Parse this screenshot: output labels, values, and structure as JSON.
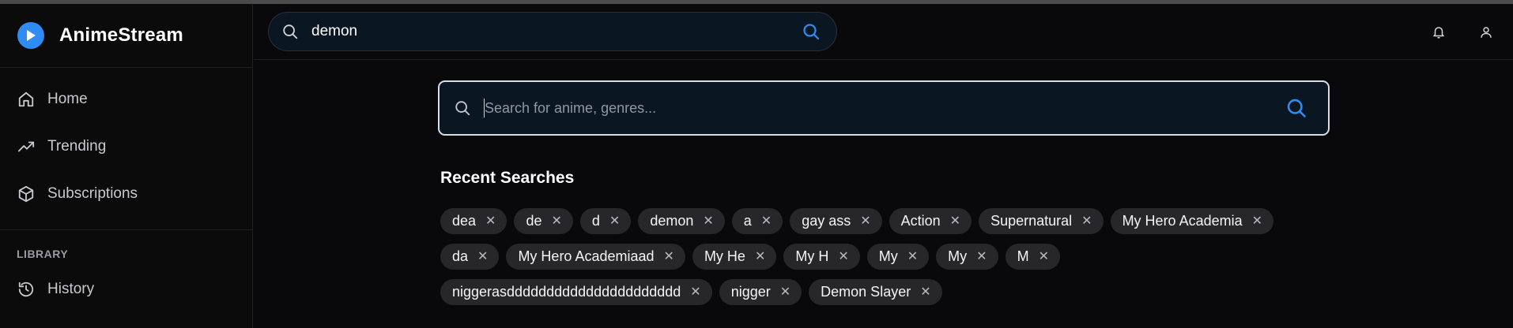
{
  "brand": {
    "name": "AnimeStream",
    "accent": "#2f8cf3"
  },
  "sidebar": {
    "items": [
      {
        "label": "Home",
        "icon": "home-icon"
      },
      {
        "label": "Trending",
        "icon": "trending-icon"
      },
      {
        "label": "Subscriptions",
        "icon": "box-icon"
      }
    ],
    "library_label": "LIBRARY",
    "library_items": [
      {
        "label": "History",
        "icon": "history-icon"
      }
    ]
  },
  "header": {
    "search_value": "demon",
    "icons": [
      "bell-icon",
      "user-icon"
    ]
  },
  "main": {
    "search_placeholder": "Search for anime, genres...",
    "recent_title": "Recent Searches",
    "recent_searches": [
      "dea",
      "de",
      "d",
      "demon",
      "a",
      "gay ass",
      "Action",
      "Supernatural",
      "My Hero Academia",
      "da",
      "My Hero Academiaad",
      "My He",
      "My H",
      "My",
      "My",
      "M",
      "niggerasdddddddddddddddddddddd",
      "nigger",
      "Demon Slayer"
    ],
    "remove_glyph": "✕"
  }
}
